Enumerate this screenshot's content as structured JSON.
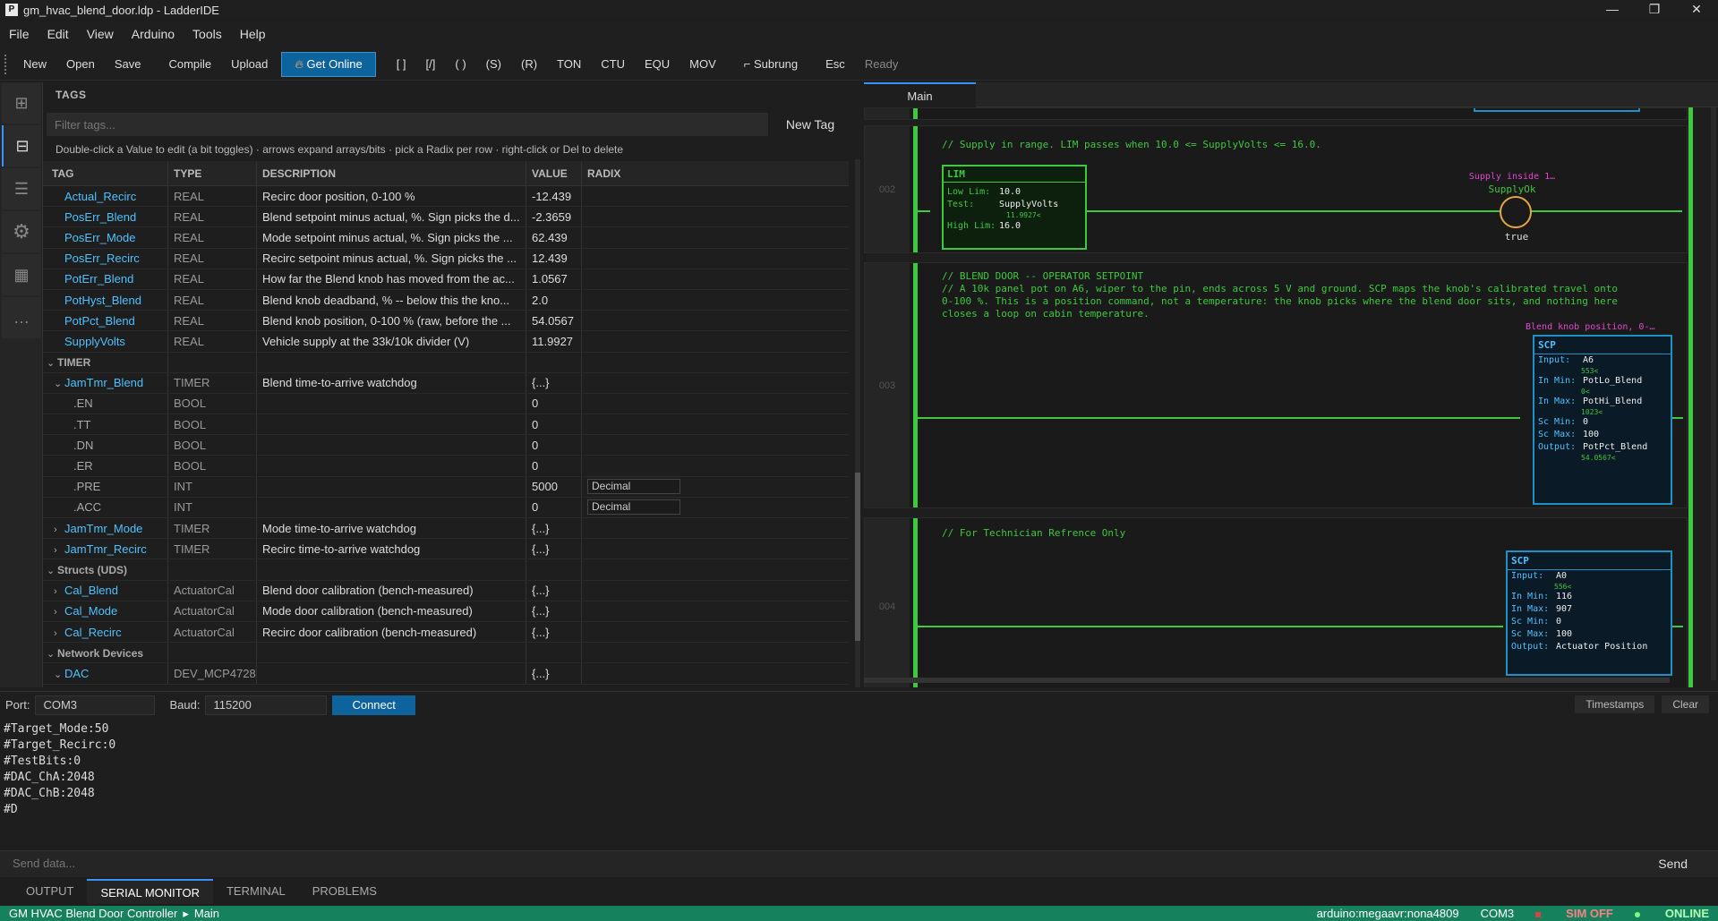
{
  "window": {
    "title": "gm_hvac_blend_door.ldp - LadderIDE",
    "appicon": "P",
    "min": "—",
    "max": "❐",
    "close": "✕"
  },
  "menu": [
    "File",
    "Edit",
    "View",
    "Arduino",
    "Tools",
    "Help"
  ],
  "toolbar": {
    "new": "New",
    "open": "Open",
    "save": "Save",
    "compile": "Compile",
    "upload": "Upload",
    "online": "Get Online",
    "tools": [
      "[ ]",
      "[/]",
      "( )",
      "(S)",
      "(R)",
      "TON",
      "CTU",
      "EQU",
      "MOV"
    ],
    "subrung": "⌐ Subrung",
    "esc": "Esc",
    "status": "Ready"
  },
  "leftbar": [
    {
      "icon": "grid-icon"
    },
    {
      "icon": "table-icon"
    },
    {
      "icon": "list-icon"
    },
    {
      "icon": "gear-icon"
    },
    {
      "icon": "device-icon"
    },
    {
      "icon": "more-icon"
    }
  ],
  "tags": {
    "header": "TAGS",
    "filter_placeholder": "Filter tags...",
    "new_tag": "New Tag",
    "hint": "Double-click a Value to edit (a bit toggles) · arrows expand arrays/bits · pick a Radix per row · right-click or Del to delete",
    "columns": {
      "tag": "TAG",
      "type": "TYPE",
      "description": "DESCRIPTION",
      "value": "VALUE",
      "radix": "RADIX"
    },
    "rows": [
      {
        "kind": "tag",
        "indent": 1,
        "name": "Actual_Recirc",
        "type": "REAL",
        "desc": "Recirc door position, 0-100 %",
        "value": "-12.439",
        "radix": ""
      },
      {
        "kind": "tag",
        "indent": 1,
        "name": "PosErr_Blend",
        "type": "REAL",
        "desc": "Blend setpoint minus actual, %. Sign picks the d...",
        "value": "-2.3659",
        "radix": ""
      },
      {
        "kind": "tag",
        "indent": 1,
        "name": "PosErr_Mode",
        "type": "REAL",
        "desc": "Mode setpoint minus actual, %. Sign picks the ...",
        "value": "62.439",
        "radix": ""
      },
      {
        "kind": "tag",
        "indent": 1,
        "name": "PosErr_Recirc",
        "type": "REAL",
        "desc": "Recirc setpoint minus actual, %. Sign picks the ...",
        "value": "12.439",
        "radix": ""
      },
      {
        "kind": "tag",
        "indent": 1,
        "name": "PotErr_Blend",
        "type": "REAL",
        "desc": "How far the Blend knob has moved from the ac...",
        "value": "1.0567",
        "radix": ""
      },
      {
        "kind": "tag",
        "indent": 1,
        "name": "PotHyst_Blend",
        "type": "REAL",
        "desc": "Blend knob deadband, % -- below this the kno...",
        "value": "2.0",
        "radix": ""
      },
      {
        "kind": "tag",
        "indent": 1,
        "name": "PotPct_Blend",
        "type": "REAL",
        "desc": "Blend knob position, 0-100 % (raw, before the ...",
        "value": "54.0567",
        "radix": ""
      },
      {
        "kind": "tag",
        "indent": 1,
        "name": "SupplyVolts",
        "type": "REAL",
        "desc": "Vehicle supply at the 33k/10k divider (V)",
        "value": "11.9927",
        "radix": ""
      },
      {
        "kind": "group",
        "indent": 0,
        "chev": "⌄",
        "name": "TIMER",
        "type": "",
        "desc": "",
        "value": "",
        "radix": ""
      },
      {
        "kind": "tag",
        "indent": 1,
        "chev": "⌄",
        "name": "JamTmr_Blend",
        "type": "TIMER",
        "desc": "Blend time-to-arrive watchdog",
        "value": "{...}",
        "radix": ""
      },
      {
        "kind": "sub",
        "indent": 2,
        "name": ".EN",
        "type": "BOOL",
        "desc": "",
        "value": "0",
        "radix": ""
      },
      {
        "kind": "sub",
        "indent": 2,
        "name": ".TT",
        "type": "BOOL",
        "desc": "",
        "value": "0",
        "radix": ""
      },
      {
        "kind": "sub",
        "indent": 2,
        "name": ".DN",
        "type": "BOOL",
        "desc": "",
        "value": "0",
        "radix": ""
      },
      {
        "kind": "sub",
        "indent": 2,
        "name": ".ER",
        "type": "BOOL",
        "desc": "",
        "value": "0",
        "radix": ""
      },
      {
        "kind": "sub",
        "indent": 2,
        "name": ".PRE",
        "type": "INT",
        "desc": "",
        "value": "5000",
        "radix": "Decimal"
      },
      {
        "kind": "sub",
        "indent": 2,
        "name": ".ACC",
        "type": "INT",
        "desc": "",
        "value": "0",
        "radix": "Decimal"
      },
      {
        "kind": "tag",
        "indent": 1,
        "chev": "›",
        "name": "JamTmr_Mode",
        "type": "TIMER",
        "desc": "Mode time-to-arrive watchdog",
        "value": "{...}",
        "radix": ""
      },
      {
        "kind": "tag",
        "indent": 1,
        "chev": "›",
        "name": "JamTmr_Recirc",
        "type": "TIMER",
        "desc": "Recirc time-to-arrive watchdog",
        "value": "{...}",
        "radix": ""
      },
      {
        "kind": "group",
        "indent": 0,
        "chev": "⌄",
        "name": "Structs (UDS)",
        "type": "",
        "desc": "",
        "value": "",
        "radix": ""
      },
      {
        "kind": "tag",
        "indent": 1,
        "chev": "›",
        "name": "Cal_Blend",
        "type": "ActuatorCal",
        "desc": "Blend door calibration (bench-measured)",
        "value": "{...}",
        "radix": ""
      },
      {
        "kind": "tag",
        "indent": 1,
        "chev": "›",
        "name": "Cal_Mode",
        "type": "ActuatorCal",
        "desc": "Mode door calibration (bench-measured)",
        "value": "{...}",
        "radix": ""
      },
      {
        "kind": "tag",
        "indent": 1,
        "chev": "›",
        "name": "Cal_Recirc",
        "type": "ActuatorCal",
        "desc": "Recirc door calibration (bench-measured)",
        "value": "{...}",
        "radix": ""
      },
      {
        "kind": "group",
        "indent": 0,
        "chev": "⌄",
        "name": "Network Devices",
        "type": "",
        "desc": "",
        "value": "",
        "radix": ""
      },
      {
        "kind": "tag",
        "indent": 1,
        "chev": "⌄",
        "name": "DAC",
        "type": "DEV_MCP4728",
        "desc": "",
        "value": "{...}",
        "radix": ""
      }
    ]
  },
  "editor": {
    "tab": "Main",
    "rung2": {
      "num": "002",
      "comment": "// Supply in range. LIM passes when 10.0 <= SupplyVolts <= 16.0.",
      "block": {
        "title": "LIM",
        "low_label": "Low Lim:",
        "low": "10.0",
        "test_label": "Test:",
        "test": "SupplyVolts",
        "test_live": "11.9927<",
        "high_label": "High Lim:",
        "high": "16.0"
      },
      "coil": {
        "desc": "Supply inside 1…",
        "tag": "SupplyOk",
        "state": "true"
      }
    },
    "rung3": {
      "num": "003",
      "comment": "// BLEND DOOR -- OPERATOR SETPOINT\n// A 10k panel pot on A6, wiper to the pin, ends across 5 V and ground. SCP maps the knob's calibrated travel onto\n0-100 %. This is a position command, not a temperature: the knob picks where the blend door sits, and nothing here\ncloses a loop on cabin temperature.",
      "block": {
        "desc": "Blend knob position, 0-…",
        "title": "SCP",
        "rows": [
          {
            "label": "Input:",
            "val": "A6",
            "live": "553<"
          },
          {
            "label": "In Min:",
            "val": "PotLo_Blend",
            "live": "0<"
          },
          {
            "label": "In Max:",
            "val": "PotHi_Blend",
            "live": "1023<"
          },
          {
            "label": "Sc Min:",
            "val": "0",
            "live": ""
          },
          {
            "label": "Sc Max:",
            "val": "100",
            "live": ""
          },
          {
            "label": "Output:",
            "val": "PotPct_Blend",
            "live": "54.0567<"
          }
        ]
      }
    },
    "rung4": {
      "num": "004",
      "comment": "// For Technician Refrence Only",
      "block": {
        "title": "SCP",
        "rows": [
          {
            "label": "Input:",
            "val": "A0",
            "live": "556<"
          },
          {
            "label": "In Min:",
            "val": "116",
            "live": ""
          },
          {
            "label": "In Max:",
            "val": "907",
            "live": ""
          },
          {
            "label": "Sc Min:",
            "val": "0",
            "live": ""
          },
          {
            "label": "Sc Max:",
            "val": "100",
            "live": ""
          },
          {
            "label": "Output:",
            "val": "Actuator Position",
            "live": ""
          }
        ]
      }
    }
  },
  "serial": {
    "port_label": "Port:",
    "port": "COM3",
    "baud_label": "Baud:",
    "baud": "115200",
    "connect": "Connect",
    "timestamps": "Timestamps",
    "clear": "Clear",
    "lines": [
      "#Target_Mode:50",
      "#Target_Recirc:0",
      "#TestBits:0",
      "#DAC_ChA:2048",
      "#DAC_ChB:2048",
      "#D"
    ],
    "send_placeholder": "Send data...",
    "send": "Send"
  },
  "panel_tabs": [
    "OUTPUT",
    "SERIAL MONITOR",
    "TERMINAL",
    "PROBLEMS"
  ],
  "status": {
    "project": "GM HVAC Blend Door Controller",
    "sep": "▸",
    "routine": "Main",
    "board": "arduino:megaavr:nona4809",
    "port": "COM3",
    "sim": "SIM OFF",
    "online": "ONLINE"
  },
  "colors": {
    "accent": "#0e639c",
    "rung_green": "#3ec83e",
    "tag_blue": "#4fc1ff",
    "status_green": "#16825d",
    "sim_red": "#e04040"
  }
}
